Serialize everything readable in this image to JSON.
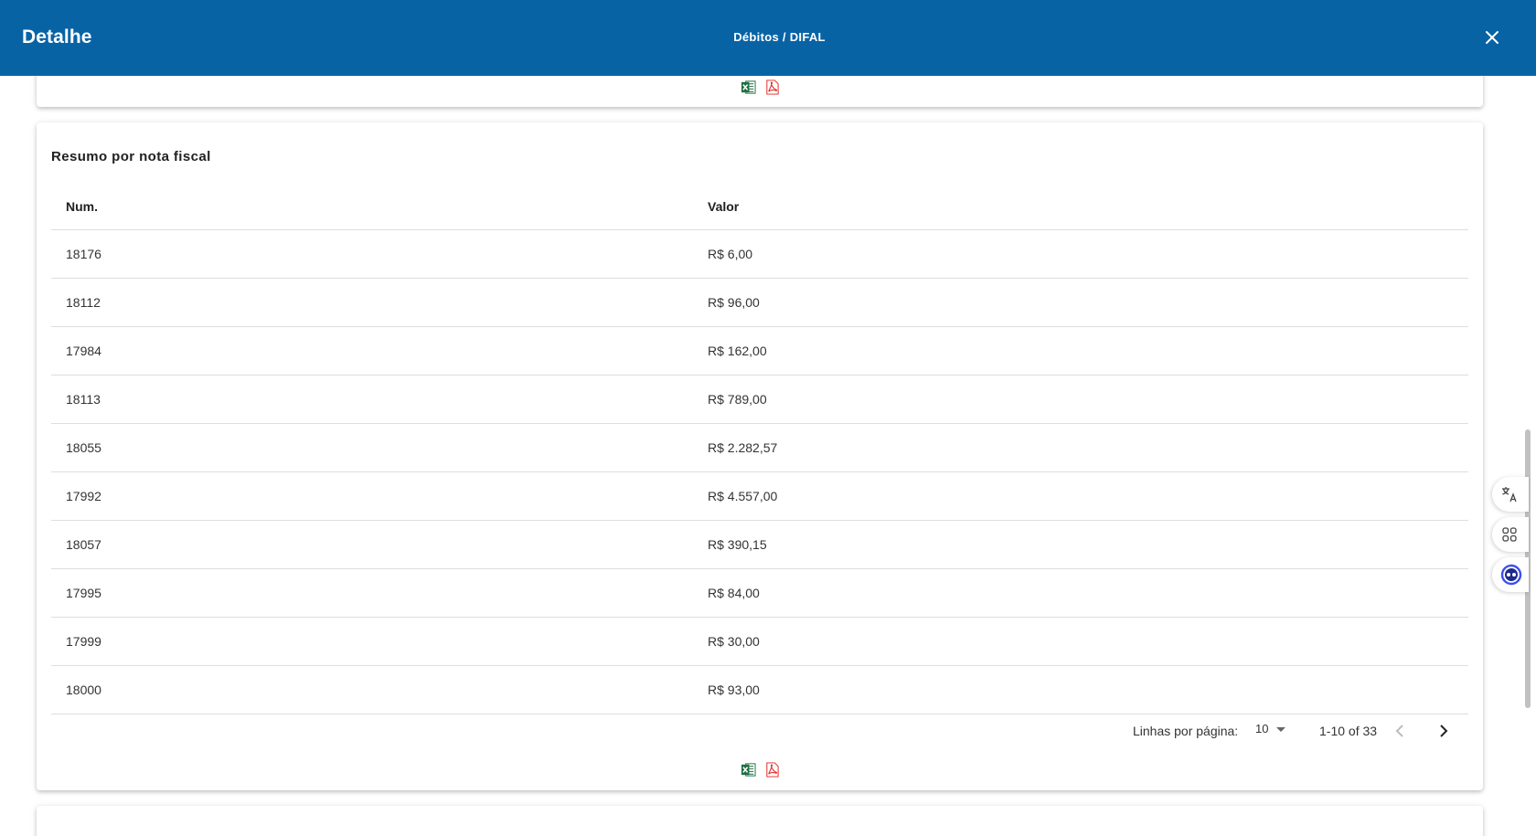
{
  "header": {
    "title": "Detalhe",
    "breadcrumb": "Débitos / DIFAL",
    "close_icon": "close-icon"
  },
  "exports": {
    "excel_icon": "excel-icon",
    "pdf_icon": "pdf-icon"
  },
  "summary": {
    "title": "Resumo por nota fiscal",
    "columns": {
      "num": "Num.",
      "valor": "Valor"
    },
    "rows": [
      {
        "num": "18176",
        "valor": "R$ 6,00"
      },
      {
        "num": "18112",
        "valor": "R$ 96,00"
      },
      {
        "num": "17984",
        "valor": "R$ 162,00"
      },
      {
        "num": "18113",
        "valor": "R$ 789,00"
      },
      {
        "num": "18055",
        "valor": "R$ 2.282,57"
      },
      {
        "num": "17992",
        "valor": "R$ 4.557,00"
      },
      {
        "num": "18057",
        "valor": "R$ 390,15"
      },
      {
        "num": "17995",
        "valor": "R$ 84,00"
      },
      {
        "num": "17999",
        "valor": "R$ 30,00"
      },
      {
        "num": "18000",
        "valor": "R$ 93,00"
      }
    ]
  },
  "pagination": {
    "rows_per_page_label": "Linhas por página:",
    "rows_per_page": "10",
    "range": "1-10 of 33"
  },
  "side_tools": [
    "translate-icon",
    "apps-icon",
    "assistant-icon"
  ],
  "colors": {
    "header_bg": "#0863a5",
    "excel_green": "#1d6f42",
    "pdf_red": "#e0231d",
    "assistant_blue": "#3b4ff0"
  }
}
